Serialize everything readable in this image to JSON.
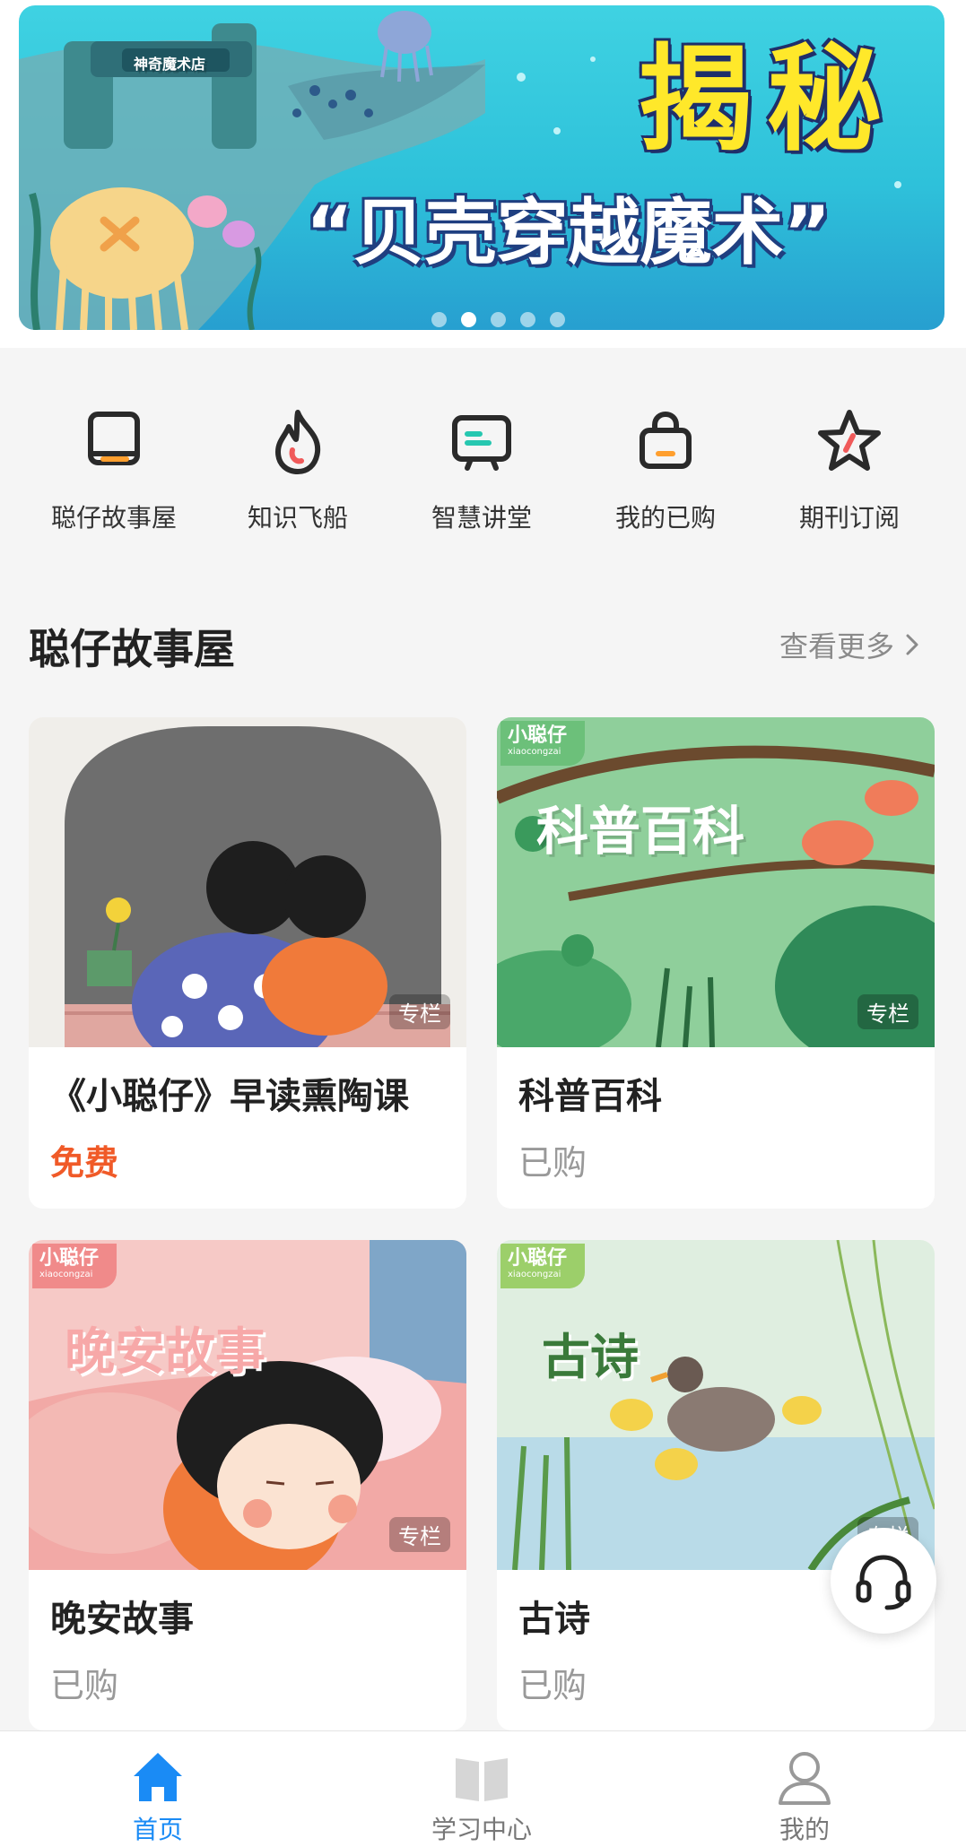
{
  "banner": {
    "title": "揭秘",
    "subtitle": "“贝壳穿越魔术”",
    "sign_text": "神奇魔术店",
    "slide_count": 5,
    "active_slide": 2
  },
  "quick_nav": [
    {
      "label": "聪仔故事屋",
      "icon": "book-icon"
    },
    {
      "label": "知识飞船",
      "icon": "flame-icon"
    },
    {
      "label": "智慧讲堂",
      "icon": "screen-icon"
    },
    {
      "label": "我的已购",
      "icon": "bag-icon"
    },
    {
      "label": "期刊订阅",
      "icon": "star-icon"
    }
  ],
  "section": {
    "title": "聪仔故事屋",
    "more": "查看更多"
  },
  "cards": [
    {
      "title": "《小聪仔》早读熏陶课",
      "status": "免费",
      "tag": "专栏",
      "image_text": ""
    },
    {
      "title": "科普百科",
      "status": "已购",
      "tag": "专栏",
      "image_text": "科普百科",
      "brand": "小聪仔",
      "brand_sub": "xiaocongzai"
    },
    {
      "title": "晚安故事",
      "status": "已购",
      "tag": "专栏",
      "image_text": "晚安故事",
      "brand": "小聪仔",
      "brand_sub": "xiaocongzai"
    },
    {
      "title": "古诗",
      "status": "已购",
      "tag": "专栏",
      "image_text": "古诗",
      "brand": "小聪仔",
      "brand_sub": "xiaocongzai"
    }
  ],
  "tabbar": [
    {
      "label": "首页",
      "icon": "home-icon",
      "active": true
    },
    {
      "label": "学习中心",
      "icon": "open-book-icon",
      "active": false
    },
    {
      "label": "我的",
      "icon": "user-icon",
      "active": false
    }
  ],
  "colors": {
    "accent": "#1a8bf5",
    "free": "#f05a28",
    "icon_highlight": "#ff9f2e"
  }
}
